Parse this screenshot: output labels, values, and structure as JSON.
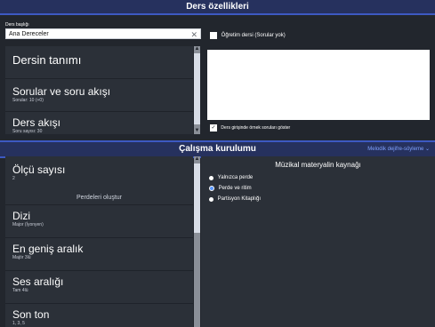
{
  "top_section": {
    "title": "Ders özellikleri",
    "lesson_name_label": "Ders başlığı",
    "lesson_name_value": "Ana Dereceler",
    "checkbox_label": "Öğretim dersi (Sorular yok)",
    "items": [
      {
        "title": "Dersin tanımı",
        "subtitle": ""
      },
      {
        "title": "Sorular ve soru akışı",
        "subtitle": "Sorular: 10 (+0)"
      },
      {
        "title": "Ders akışı",
        "subtitle": "Soru sayısı: 30"
      }
    ],
    "bottom_checkbox_label": "Ders girişinde örnek soruları göster",
    "bottom_checkbox_checked": "✓"
  },
  "bottom_section": {
    "title": "Çalışma kurulumu",
    "mode_label": "Melodik dejifre-söyleme",
    "items": [
      {
        "title": "Ölçü sayısı",
        "subtitle": "2"
      },
      {
        "title": "Dizi",
        "subtitle": "Major (İyonyen)"
      },
      {
        "title": "En geniş aralık",
        "subtitle": "Majör 3lü"
      },
      {
        "title": "Ses aralığı",
        "subtitle": "Tam 4lü"
      },
      {
        "title": "Son ton",
        "subtitle": "1, 3, 5"
      }
    ],
    "generate_header": "Perdeleri oluştur",
    "music_source_header": "Müzikal materyalin kaynağı",
    "options": [
      {
        "label": "Yalnızca perde",
        "selected": false
      },
      {
        "label": "Perde ve ritim",
        "selected": true
      },
      {
        "label": "Partisyon Kitaplığı",
        "selected": false
      }
    ],
    "scroll_note_top": "Perde ve ritim"
  },
  "icons": {
    "clear": "clear-icon",
    "chevron": "chevron-down-icon",
    "scroll_up": "scroll-up-icon",
    "scroll_down": "scroll-down-icon",
    "checkbox_checked": "checkmark-icon"
  },
  "colors": {
    "title_bg": "#26315e",
    "accent": "#3d59c2",
    "panel": "#2b3038",
    "background": "#22262d",
    "radio_selected": "#5a98ff",
    "link": "#7fa1ff"
  }
}
